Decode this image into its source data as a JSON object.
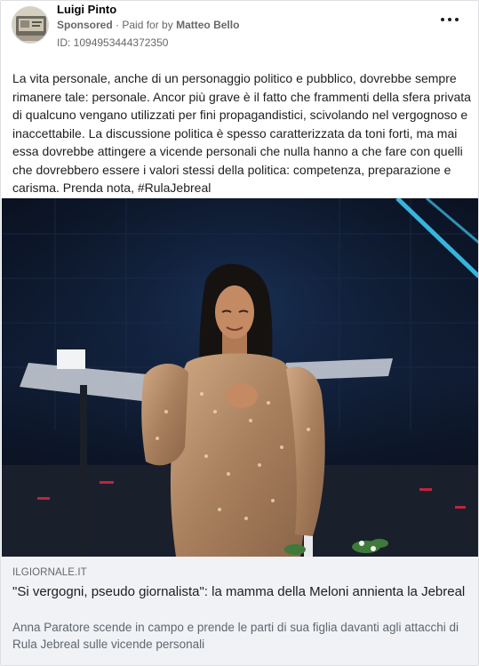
{
  "post": {
    "author": "Luigi Pinto",
    "sponsored_label": "Sponsored",
    "paid_for_prefix": "Paid for by",
    "payer": "Matteo Bello",
    "ad_id": "ID: 1094953444372350",
    "more_icon": "more-horizontal-icon",
    "body": "La vita personale, anche di un personaggio politico e pubblico, dovrebbe sempre rimanere tale: personale. Ancor più grave è il fatto che frammenti della sfera privata di qualcuno vengano utilizzati per fini propagandistici, scivolando nel vergognoso e inaccettabile. La discussione politica è spesso caratterizzata da toni forti, ma mai essa dovrebbe attingere a vicende personali che nulla hanno a che fare con quelli che dovrebbero essere i valori stessi della politica: competenza, preparazione e carisma. Prenda nota, #RulaJebreal"
  },
  "link_preview": {
    "domain": "ILGIORNALE.IT",
    "headline": "\"Si vergogni, pseudo giornalista\": la mamma della Meloni annienta la Jebreal",
    "description": "Anna Paratore scende in campo e prende le parti di sua figlia davanti agli attacchi di Rula Jebreal sulle vicende personali"
  },
  "colors": {
    "background": "#ffffff",
    "secondary_text": "#65676b",
    "link_box_bg": "#f0f2f5",
    "stage_dark": "#0b1424",
    "stage_light": "#3cc7f0",
    "dress": "#b8906a"
  }
}
